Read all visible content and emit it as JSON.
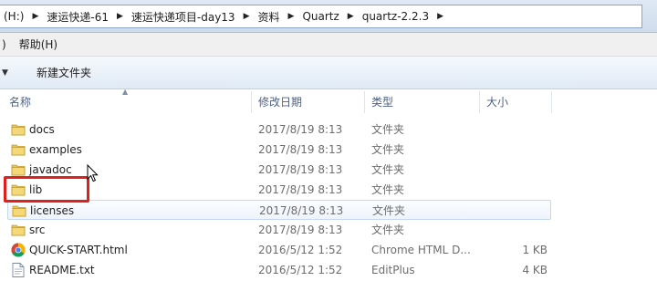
{
  "address_bar": {
    "crumbs": [
      "(H:)",
      "速运快递-61",
      "速运快递项目-day13",
      "资料",
      "Quartz",
      "quartz-2.2.3"
    ]
  },
  "menu": {
    "partial": ")",
    "help": "帮助(H)"
  },
  "toolbar": {
    "new_folder": "新建文件夹"
  },
  "columns": {
    "name": "名称",
    "modified": "修改日期",
    "type": "类型",
    "size": "大小"
  },
  "files": [
    {
      "name": "docs",
      "modified": "2017/8/19 8:13",
      "type": "文件夹",
      "size": "",
      "icon": "folder-icon"
    },
    {
      "name": "examples",
      "modified": "2017/8/19 8:13",
      "type": "文件夹",
      "size": "",
      "icon": "folder-icon"
    },
    {
      "name": "javadoc",
      "modified": "2017/8/19 8:13",
      "type": "文件夹",
      "size": "",
      "icon": "folder-icon"
    },
    {
      "name": "lib",
      "modified": "2017/8/19 8:13",
      "type": "文件夹",
      "size": "",
      "icon": "folder-icon"
    },
    {
      "name": "licenses",
      "modified": "2017/8/19 8:13",
      "type": "文件夹",
      "size": "",
      "icon": "folder-icon"
    },
    {
      "name": "src",
      "modified": "2017/8/19 8:13",
      "type": "文件夹",
      "size": "",
      "icon": "folder-icon"
    },
    {
      "name": "QUICK-START.html",
      "modified": "2016/5/12 1:52",
      "type": "Chrome HTML D...",
      "size": "1 KB",
      "icon": "chrome-icon"
    },
    {
      "name": "README.txt",
      "modified": "2016/5/12 1:52",
      "type": "EditPlus",
      "size": "4 KB",
      "icon": "text-file-icon"
    }
  ],
  "colors": {
    "highlight_box": "#e0201d",
    "header_text": "#4d6185",
    "folder": "#e8c65a"
  }
}
